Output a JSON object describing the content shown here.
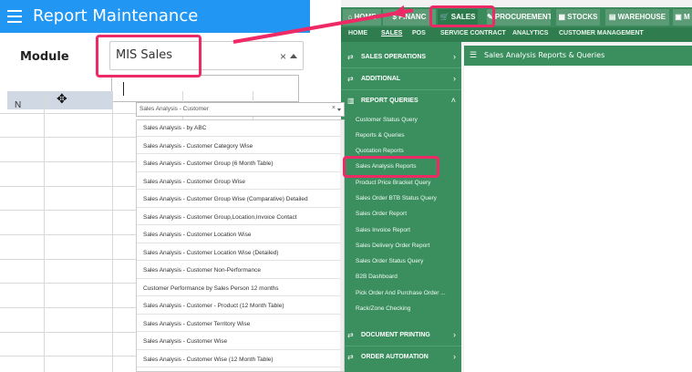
{
  "left_app": {
    "title": "Report Maintenance",
    "module_label": "Module",
    "module_value": "MIS Sales",
    "clear_symbol": "×",
    "grid_header_fragment": "N"
  },
  "right_app": {
    "top_tabs": [
      {
        "label": "⌂ HOME"
      },
      {
        "label": "$ FINANC"
      },
      {
        "label": "🛒 SALES"
      },
      {
        "label": "✎ PROCUREMENT"
      },
      {
        "label": "▦ STOCKS"
      },
      {
        "label": "▤ WAREHOUSE"
      },
      {
        "label": "▣ M"
      }
    ],
    "sub_nav": [
      "HOME",
      "SALES",
      "POS",
      "SERVICE CONTRACT",
      "ANALYTICS",
      "CUSTOMER MANAGEMENT"
    ],
    "sidebar": {
      "sections": [
        {
          "label": "SALES OPERATIONS",
          "icon": "⇄",
          "chevron": "›"
        },
        {
          "label": "ADDITIONAL",
          "icon": "⇄",
          "chevron": "›"
        },
        {
          "label": "REPORT QUERIES",
          "icon": "▥",
          "chevron": "˄"
        }
      ],
      "links": [
        "Customer Status Query",
        "Reports & Queries",
        "Quotation Reports",
        "Sales Analysis Reports",
        "Product Price Bracket Query",
        "Sales Order BTB Status Query",
        "Sales Order Report",
        "Sales Invoice Report",
        "Sales Delivery Order Report",
        "Sales Order Status Query",
        "B2B Dashboard",
        "Pick Order And Purchase Order ...",
        "Rack/Zone Checking"
      ],
      "bottom_sections": [
        {
          "label": "DOCUMENT PRINTING",
          "icon": "⇄",
          "chevron": "›"
        },
        {
          "label": "ORDER AUTOMATION",
          "icon": "⇄",
          "chevron": "›"
        }
      ]
    },
    "content_title": "Sales Analysis Reports & Queries",
    "content_icon": "☰",
    "report_select_value": "Sales Analysis - Customer",
    "report_select_clear": "×",
    "options": [
      "Sales Analysis - by ABC",
      "Sales Analysis - Customer Category Wise",
      "Sales Analysis - Customer Group (6 Month Table)",
      "Sales Analysis - Customer Group Wise",
      "Sales Analysis - Customer Group Wise (Comparative) Detailed",
      "Sales Analysis - Customer Group,Location,Invoice Contact",
      "Sales Analysis - Customer Location Wise",
      "Sales Analysis - Customer Location Wise (Detailed)",
      "Sales Analysis - Customer Non-Performance",
      "Customer Performance by Sales Person 12 months",
      "Sales Analysis - Customer - Product (12 Month Table)",
      "Sales Analysis - Customer Territory Wise",
      "Sales Analysis - Customer Wise",
      "Sales Analysis - Customer Wise (12 Month Table)"
    ]
  },
  "colors": {
    "header_blue": "#2196f3",
    "green_nav": "#3a8a5b",
    "annotation_pink": "#ee2a66"
  }
}
